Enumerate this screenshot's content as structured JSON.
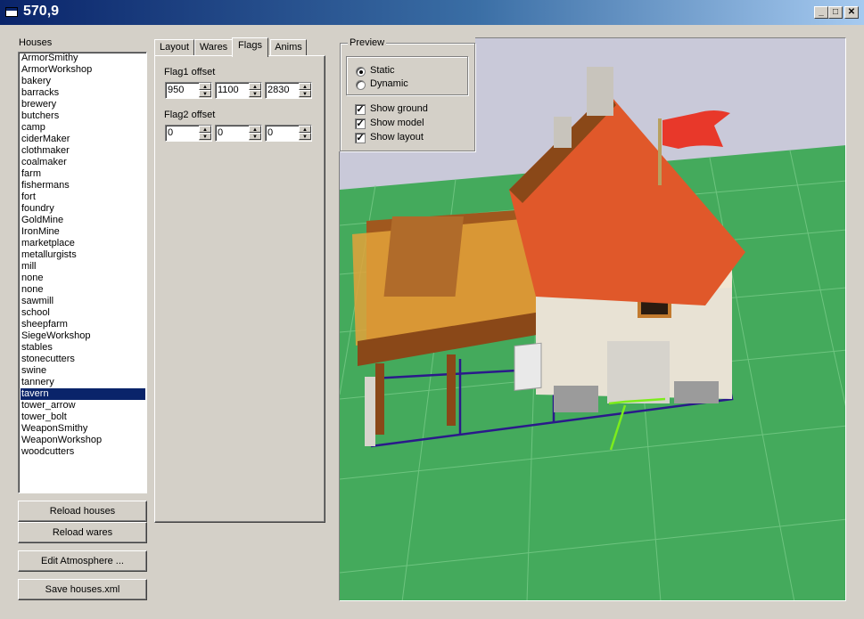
{
  "window": {
    "title": "570,9",
    "controls": {
      "minimize": "_",
      "maximize": "□",
      "close": "✕"
    }
  },
  "houses": {
    "label": "Houses",
    "items": [
      "ArmorSmithy",
      "ArmorWorkshop",
      "bakery",
      "barracks",
      "brewery",
      "butchers",
      "camp",
      "ciderMaker",
      "clothmaker",
      "coalmaker",
      "farm",
      "fishermans",
      "fort",
      "foundry",
      "GoldMine",
      "IronMine",
      "marketplace",
      "metallurgists",
      "mill",
      "none",
      "none",
      "sawmill",
      "school",
      "sheepfarm",
      "SiegeWorkshop",
      "stables",
      "stonecutters",
      "swine",
      "tannery",
      "tavern",
      "tower_arrow",
      "tower_bolt",
      "WeaponSmithy",
      "WeaponWorkshop",
      "woodcutters"
    ],
    "selected": "tavern"
  },
  "buttons": {
    "reload_houses": "Reload houses",
    "reload_wares": "Reload wares",
    "edit_atmosphere": "Edit Atmosphere ...",
    "save_houses": "Save houses.xml"
  },
  "tabs": {
    "items": [
      "Layout",
      "Wares",
      "Flags",
      "Anims"
    ],
    "active": "Flags"
  },
  "flags": {
    "flag1_label": "Flag1 offset",
    "flag1_values": [
      "950",
      "1100",
      "2830"
    ],
    "flag2_label": "Flag2 offset",
    "flag2_values": [
      "0",
      "0",
      "0"
    ]
  },
  "preview": {
    "title": "Preview",
    "mode_static": "Static",
    "mode_dynamic": "Dynamic",
    "mode_selected": "Static",
    "show_ground": "Show ground",
    "show_model": "Show model",
    "show_layout": "Show layout",
    "checks": {
      "ground": true,
      "model": true,
      "layout": true
    }
  },
  "colors": {
    "titlebar_start": "#0a246a",
    "selection": "#0a246a",
    "ground": "#44aa5c",
    "sky": "#c9c9d9",
    "roof": "#e0582a",
    "layout_lines": "#2a1a8a",
    "flag_marker": "#7cec1c"
  }
}
